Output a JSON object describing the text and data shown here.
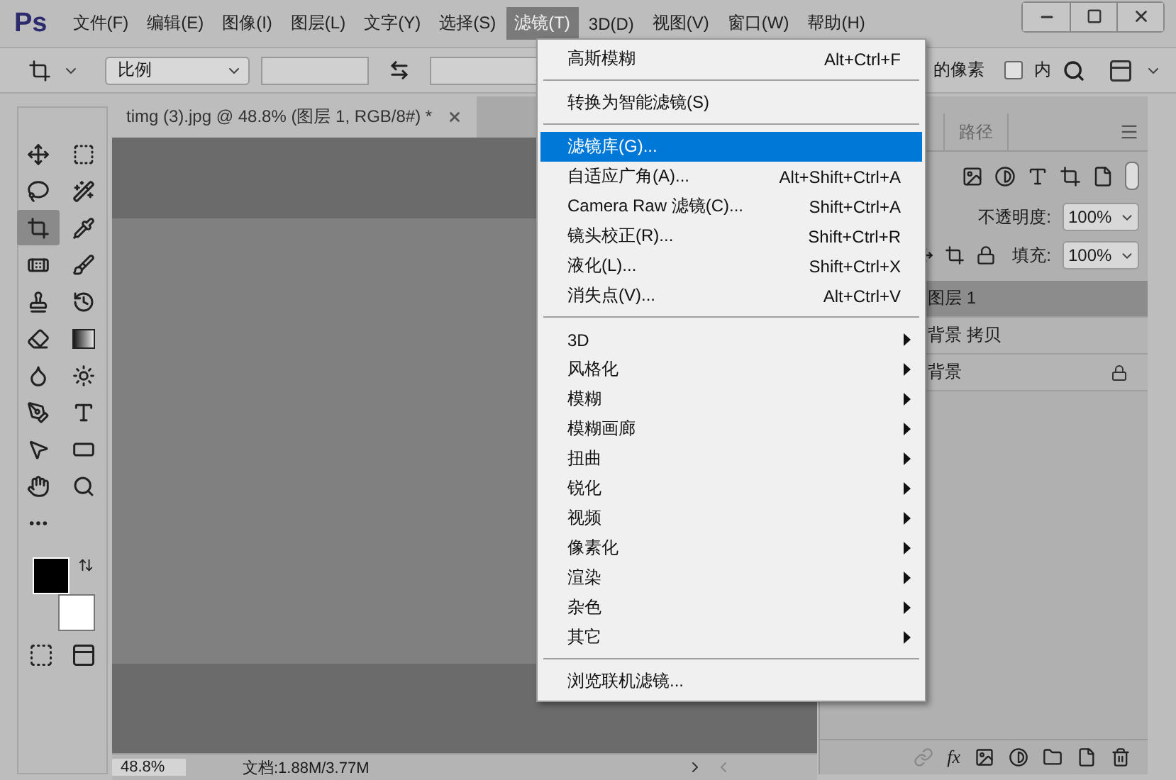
{
  "app": {
    "logo": "Ps"
  },
  "menubar": [
    {
      "label": "文件(F)",
      "selected": false
    },
    {
      "label": "编辑(E)",
      "selected": false
    },
    {
      "label": "图像(I)",
      "selected": false
    },
    {
      "label": "图层(L)",
      "selected": false
    },
    {
      "label": "文字(Y)",
      "selected": false
    },
    {
      "label": "选择(S)",
      "selected": false
    },
    {
      "label": "滤镜(T)",
      "selected": true
    },
    {
      "label": "3D(D)",
      "selected": false
    },
    {
      "label": "视图(V)",
      "selected": false
    },
    {
      "label": "窗口(W)",
      "selected": false
    },
    {
      "label": "帮助(H)",
      "selected": false
    }
  ],
  "options_bar": {
    "ratio": "比例",
    "delete_pixels_label": "的像素",
    "content_aware": {
      "label": "内",
      "checked": false
    }
  },
  "document_tab": {
    "title": "timg (3).jpg @ 48.8% (图层 1, RGB/8#) *"
  },
  "tools": [
    {
      "selected": false
    },
    {
      "selected": false
    },
    {
      "selected": false
    },
    {
      "selected": false
    },
    {
      "selected": true
    },
    {
      "selected": false
    },
    {
      "selected": false
    },
    {
      "selected": false
    },
    {
      "selected": false
    },
    {
      "selected": false
    },
    {
      "selected": false
    },
    {
      "selected": false
    },
    {
      "selected": false
    },
    {
      "selected": false
    },
    {
      "selected": false
    },
    {
      "selected": false
    },
    {
      "selected": false
    },
    {
      "selected": false
    },
    {
      "selected": false
    },
    {
      "selected": false
    },
    {
      "selected": false
    }
  ],
  "status_bar": {
    "zoom": "48.8%",
    "doc_info": "文档:1.88M/3.77M"
  },
  "panel": {
    "tabs": [
      {
        "label": "路径",
        "selected": false
      }
    ],
    "opacity_label": "不透明度:",
    "opacity": "100%",
    "fill_label": "填充:",
    "fill": "100%",
    "effects_label": "fx"
  },
  "layers": [
    {
      "name": "图层 1",
      "selected": true,
      "locked": false
    },
    {
      "name": "背景 拷贝",
      "selected": false,
      "locked": false
    },
    {
      "name": "背景",
      "selected": false,
      "locked": true
    }
  ],
  "filter_menu": {
    "items": [
      {
        "kind": "item",
        "label": "高斯模糊",
        "shortcut": "Alt+Ctrl+F",
        "selected": false
      },
      {
        "kind": "separator"
      },
      {
        "kind": "item",
        "label": "转换为智能滤镜(S)",
        "selected": false
      },
      {
        "kind": "separator"
      },
      {
        "kind": "item",
        "label": "滤镜库(G)...",
        "selected": true
      },
      {
        "kind": "item",
        "label": "自适应广角(A)...",
        "shortcut": "Alt+Shift+Ctrl+A",
        "selected": false
      },
      {
        "kind": "item",
        "label": "Camera Raw 滤镜(C)...",
        "shortcut": "Shift+Ctrl+A",
        "selected": false
      },
      {
        "kind": "item",
        "label": "镜头校正(R)...",
        "shortcut": "Shift+Ctrl+R",
        "selected": false
      },
      {
        "kind": "item",
        "label": "液化(L)...",
        "shortcut": "Shift+Ctrl+X",
        "selected": false
      },
      {
        "kind": "item",
        "label": "消失点(V)...",
        "shortcut": "Alt+Ctrl+V",
        "selected": false
      },
      {
        "kind": "separator"
      },
      {
        "kind": "submenu",
        "label": "3D",
        "selected": false
      },
      {
        "kind": "submenu",
        "label": "风格化",
        "selected": false
      },
      {
        "kind": "submenu",
        "label": "模糊",
        "selected": false
      },
      {
        "kind": "submenu",
        "label": "模糊画廊",
        "selected": false
      },
      {
        "kind": "submenu",
        "label": "扭曲",
        "selected": false
      },
      {
        "kind": "submenu",
        "label": "锐化",
        "selected": false
      },
      {
        "kind": "submenu",
        "label": "视频",
        "selected": false
      },
      {
        "kind": "submenu",
        "label": "像素化",
        "selected": false
      },
      {
        "kind": "submenu",
        "label": "渲染",
        "selected": false
      },
      {
        "kind": "submenu",
        "label": "杂色",
        "selected": false
      },
      {
        "kind": "submenu",
        "label": "其它",
        "selected": false
      },
      {
        "kind": "separator"
      },
      {
        "kind": "item",
        "label": "浏览联机滤镜...",
        "selected": false
      }
    ]
  }
}
